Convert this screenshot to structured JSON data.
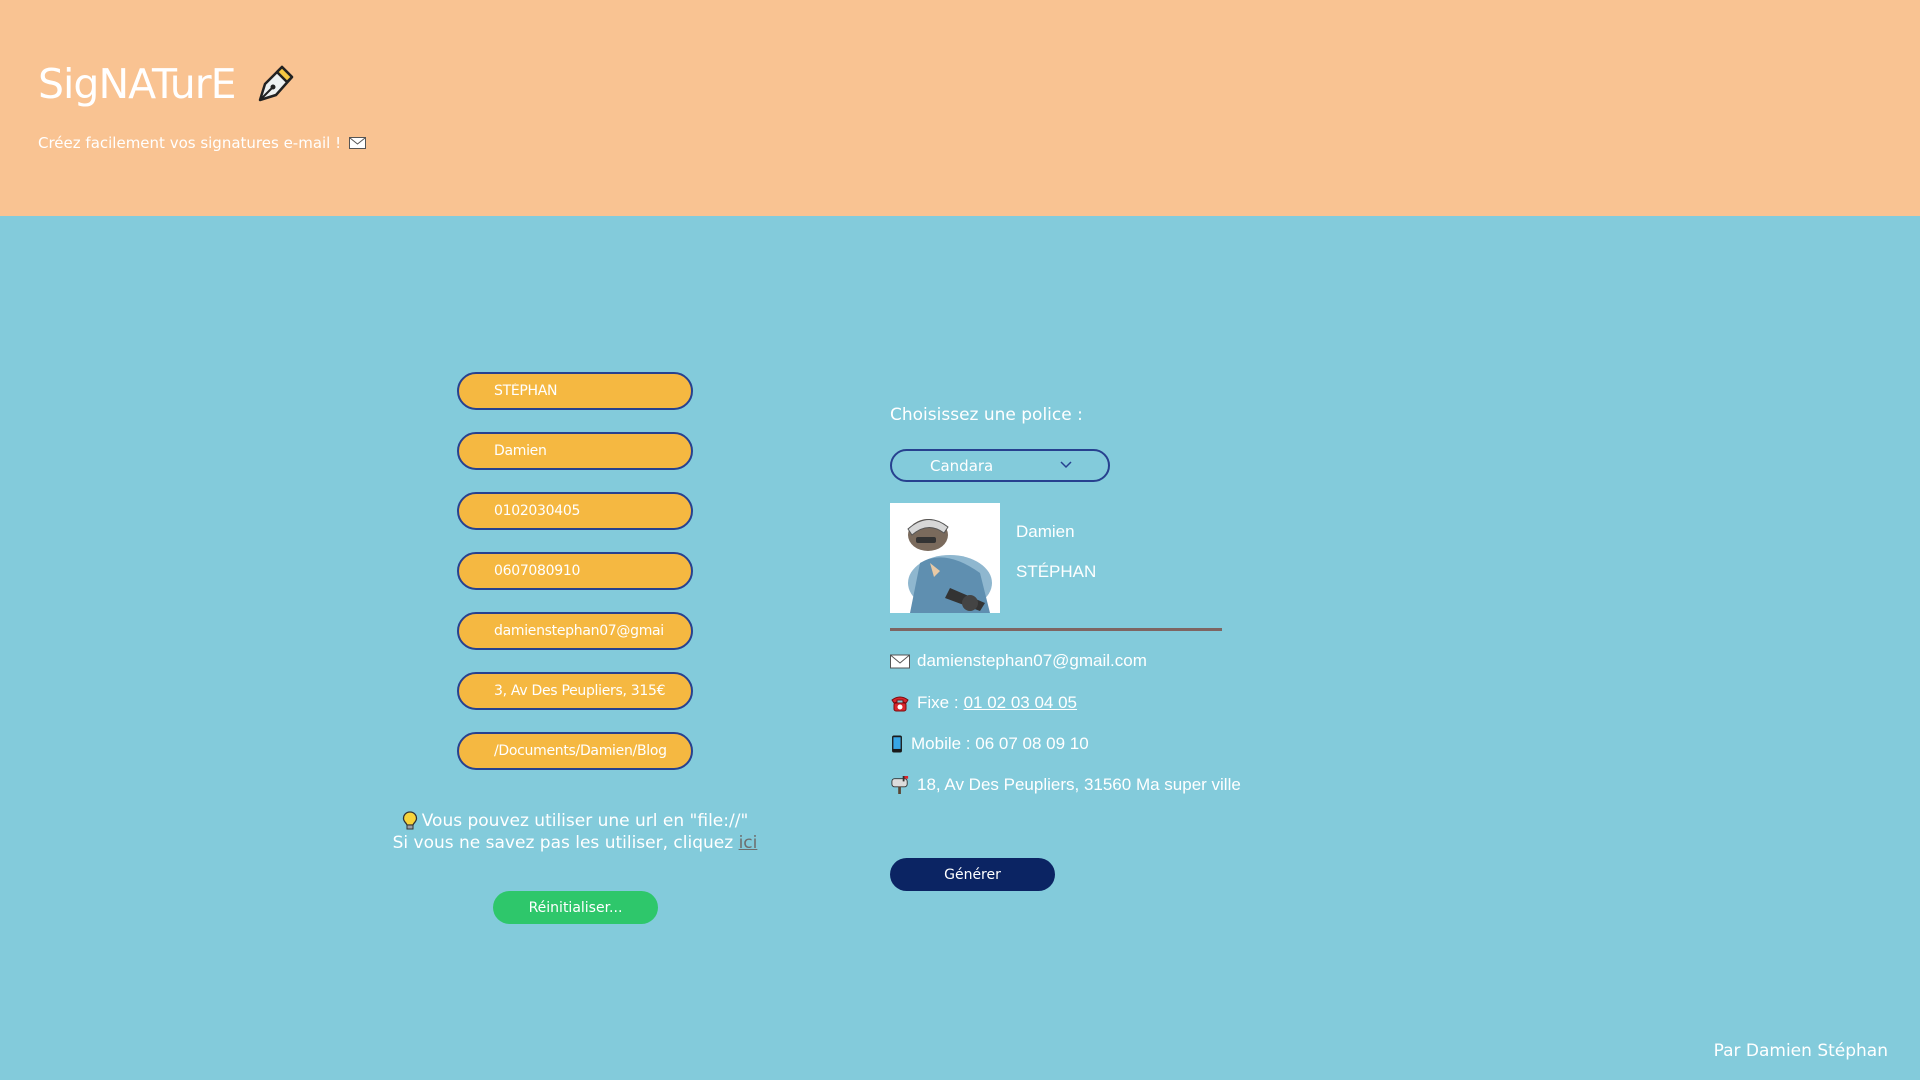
{
  "header": {
    "title": "SigNATurE",
    "subtitle": "Créez facilement vos signatures e-mail !"
  },
  "form": {
    "fields": [
      {
        "name": "lastname",
        "value": "STÉPHAN"
      },
      {
        "name": "firstname",
        "value": "Damien"
      },
      {
        "name": "phone",
        "value": "0102030405"
      },
      {
        "name": "mobile",
        "value": "0607080910"
      },
      {
        "name": "email",
        "value": "damienstephan07@gmai"
      },
      {
        "name": "address",
        "value": "3, Av Des Peupliers, 315€"
      },
      {
        "name": "photo-path",
        "value": "/Documents/Damien/Blog"
      }
    ],
    "tip_line1": "Vous pouvez utiliser une url en \"file://\"",
    "tip_line2": "Si vous ne savez pas les utiliser, cliquez",
    "tip_link": "ici",
    "reset_label": "Réinitialiser..."
  },
  "preview": {
    "font_label": "Choisissez une police :",
    "font_selected": "Candara",
    "firstname": "Damien",
    "lastname": "STÉPHAN",
    "email": "damienstephan07@gmail.com",
    "phone_label": "Fixe :",
    "phone_value": "01 02 03 04 05",
    "mobile": "Mobile : 06 07 08 09 10",
    "address": "18, Av Des Peupliers, 31560 Ma super ville",
    "generate_label": "Générer"
  },
  "footer": {
    "credit": "Par Damien Stéphan"
  },
  "colors": {
    "header_bg": "#f9c392",
    "page_bg": "#83cbdb",
    "field_bg": "#f5b841",
    "field_border": "#27418f",
    "reset_bg": "#2ec76b",
    "generate_bg": "#0b2463"
  },
  "icons": [
    "pen-icon",
    "envelope-icon",
    "lightbulb-icon",
    "chevron-down-icon",
    "telephone-icon",
    "mobile-phone-icon",
    "mailbox-icon"
  ]
}
